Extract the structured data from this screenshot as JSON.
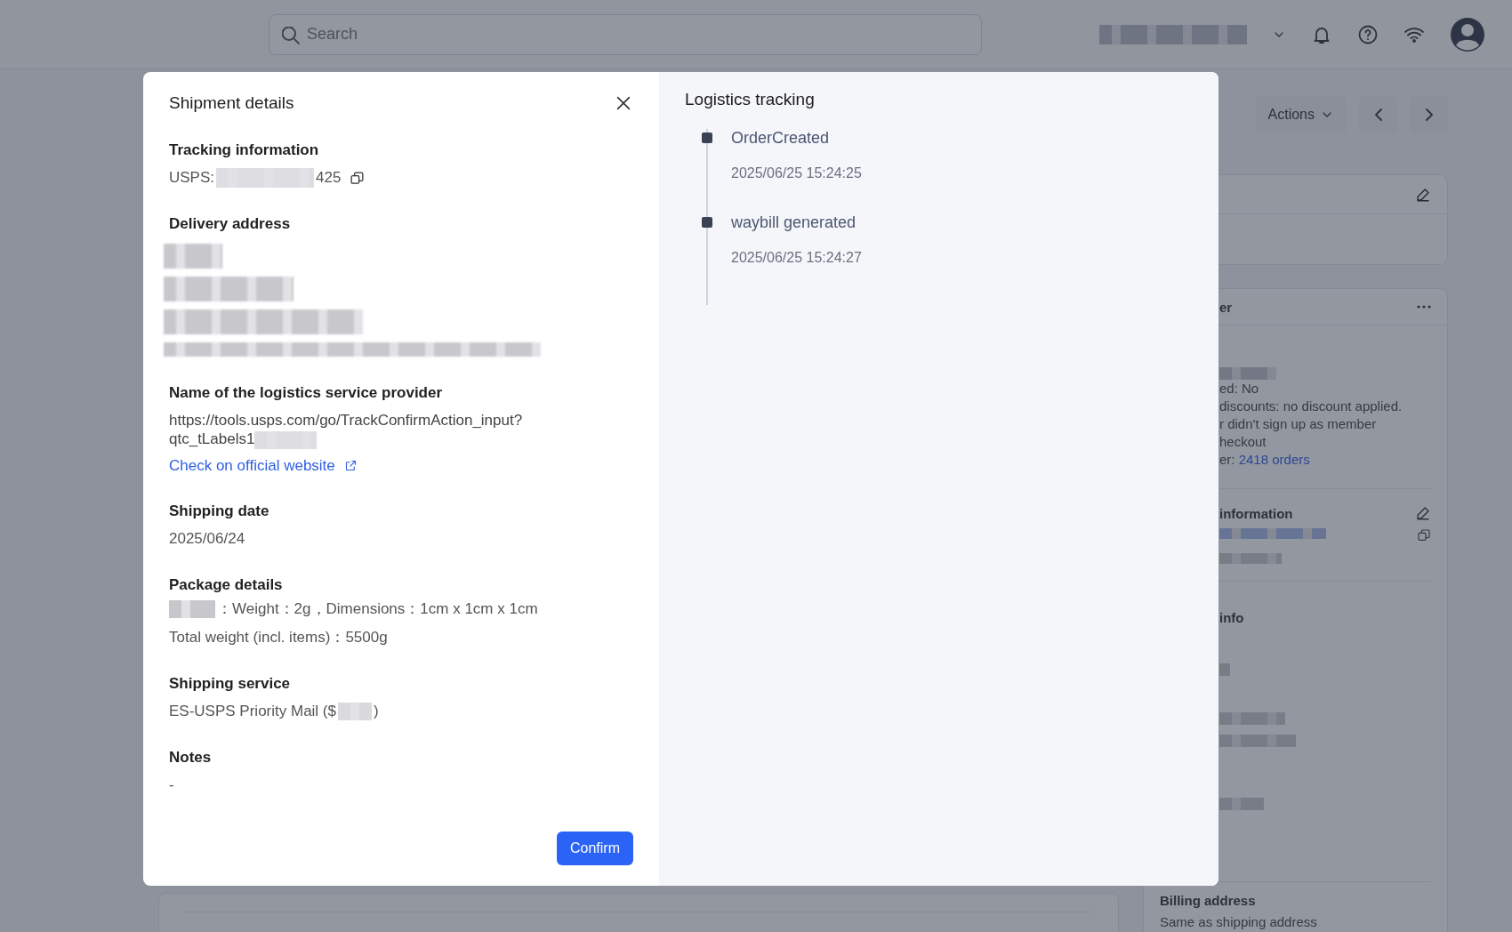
{
  "top_bar": {
    "search": {
      "placeholder": "Search"
    }
  },
  "page": {
    "actions_button": "Actions",
    "customer_card": {
      "title": "er",
      "lines": [
        "ed: No",
        "discounts: no discount applied.",
        "r didn't sign up as member",
        "heckout"
      ],
      "orders_prefix": "er: ",
      "orders_link": "2418 orders"
    },
    "contact_title": "information",
    "shipping_title": "info",
    "billing": {
      "title": "Billing address",
      "value": "Same as shipping address"
    }
  },
  "modal": {
    "title": "Shipment details",
    "sections": [
      {
        "kind": "tracking",
        "title": "Tracking information",
        "prefix": "USPS:",
        "suffix": "425"
      },
      {
        "kind": "address",
        "title": "Delivery address"
      },
      {
        "kind": "provider",
        "title": "Name of the logistics service provider",
        "url_lines": [
          "https://tools.usps.com/go/TrackConfirmAction_input?",
          "qtc_tLabels1"
        ],
        "link": "Check on official website"
      },
      {
        "kind": "text",
        "title": "Shipping date",
        "lines": [
          "2025/06/24"
        ]
      },
      {
        "kind": "package",
        "title": "Package details",
        "detail": "：Weight：2g，Dimensions：1cm x 1cm x 1cm",
        "lines": [
          "Total weight (incl. items)：5500g"
        ]
      },
      {
        "kind": "service",
        "title": "Shipping service",
        "prefix": "ES-USPS Priority Mail ($",
        "suffix": ")"
      },
      {
        "kind": "text",
        "title": "Notes",
        "lines": [
          "-"
        ]
      }
    ],
    "confirm_button": "Confirm",
    "tracking": {
      "title": "Logistics tracking",
      "events": [
        {
          "status": "OrderCreated",
          "time": "2025/06/25 15:24:25"
        },
        {
          "status": "waybill generated",
          "time": "2025/06/25 15:24:27"
        }
      ]
    }
  }
}
